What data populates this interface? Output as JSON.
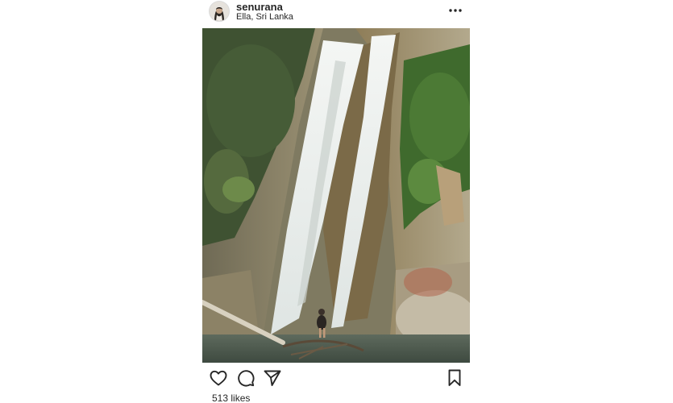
{
  "post": {
    "username": "senurana",
    "location": "Ella, Sri Lanka",
    "likes_text": "513 likes"
  },
  "icons": {
    "avatar": "avatar-icon",
    "more": "more-options-icon",
    "like": "heart-icon",
    "comment": "comment-icon",
    "share": "send-icon",
    "save": "bookmark-icon"
  },
  "photo": {
    "subject": "waterfall"
  }
}
